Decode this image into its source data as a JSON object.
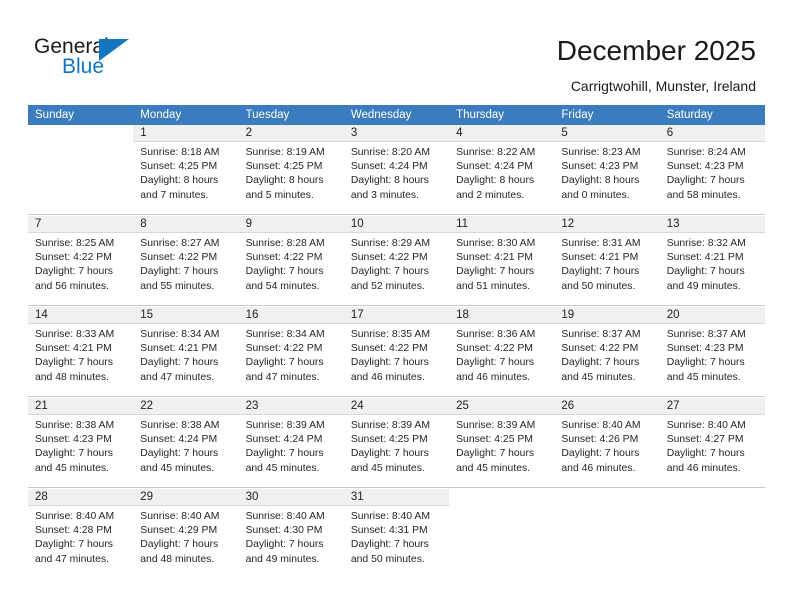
{
  "brand": {
    "name_part1": "General",
    "name_part2": "Blue",
    "triangle_icon": "triangle-icon",
    "accent_color": "#1175c0"
  },
  "header": {
    "title": "December 2025",
    "subtitle": "Carrigtwohill, Munster, Ireland"
  },
  "calendar": {
    "header_color": "#3a7cbe",
    "weekdays": [
      "Sunday",
      "Monday",
      "Tuesday",
      "Wednesday",
      "Thursday",
      "Friday",
      "Saturday"
    ],
    "weeks": [
      [
        {
          "day": "",
          "lines": []
        },
        {
          "day": "1",
          "lines": [
            "Sunrise: 8:18 AM",
            "Sunset: 4:25 PM",
            "Daylight: 8 hours",
            "and 7 minutes."
          ]
        },
        {
          "day": "2",
          "lines": [
            "Sunrise: 8:19 AM",
            "Sunset: 4:25 PM",
            "Daylight: 8 hours",
            "and 5 minutes."
          ]
        },
        {
          "day": "3",
          "lines": [
            "Sunrise: 8:20 AM",
            "Sunset: 4:24 PM",
            "Daylight: 8 hours",
            "and 3 minutes."
          ]
        },
        {
          "day": "4",
          "lines": [
            "Sunrise: 8:22 AM",
            "Sunset: 4:24 PM",
            "Daylight: 8 hours",
            "and 2 minutes."
          ]
        },
        {
          "day": "5",
          "lines": [
            "Sunrise: 8:23 AM",
            "Sunset: 4:23 PM",
            "Daylight: 8 hours",
            "and 0 minutes."
          ]
        },
        {
          "day": "6",
          "lines": [
            "Sunrise: 8:24 AM",
            "Sunset: 4:23 PM",
            "Daylight: 7 hours",
            "and 58 minutes."
          ]
        }
      ],
      [
        {
          "day": "7",
          "lines": [
            "Sunrise: 8:25 AM",
            "Sunset: 4:22 PM",
            "Daylight: 7 hours",
            "and 56 minutes."
          ]
        },
        {
          "day": "8",
          "lines": [
            "Sunrise: 8:27 AM",
            "Sunset: 4:22 PM",
            "Daylight: 7 hours",
            "and 55 minutes."
          ]
        },
        {
          "day": "9",
          "lines": [
            "Sunrise: 8:28 AM",
            "Sunset: 4:22 PM",
            "Daylight: 7 hours",
            "and 54 minutes."
          ]
        },
        {
          "day": "10",
          "lines": [
            "Sunrise: 8:29 AM",
            "Sunset: 4:22 PM",
            "Daylight: 7 hours",
            "and 52 minutes."
          ]
        },
        {
          "day": "11",
          "lines": [
            "Sunrise: 8:30 AM",
            "Sunset: 4:21 PM",
            "Daylight: 7 hours",
            "and 51 minutes."
          ]
        },
        {
          "day": "12",
          "lines": [
            "Sunrise: 8:31 AM",
            "Sunset: 4:21 PM",
            "Daylight: 7 hours",
            "and 50 minutes."
          ]
        },
        {
          "day": "13",
          "lines": [
            "Sunrise: 8:32 AM",
            "Sunset: 4:21 PM",
            "Daylight: 7 hours",
            "and 49 minutes."
          ]
        }
      ],
      [
        {
          "day": "14",
          "lines": [
            "Sunrise: 8:33 AM",
            "Sunset: 4:21 PM",
            "Daylight: 7 hours",
            "and 48 minutes."
          ]
        },
        {
          "day": "15",
          "lines": [
            "Sunrise: 8:34 AM",
            "Sunset: 4:21 PM",
            "Daylight: 7 hours",
            "and 47 minutes."
          ]
        },
        {
          "day": "16",
          "lines": [
            "Sunrise: 8:34 AM",
            "Sunset: 4:22 PM",
            "Daylight: 7 hours",
            "and 47 minutes."
          ]
        },
        {
          "day": "17",
          "lines": [
            "Sunrise: 8:35 AM",
            "Sunset: 4:22 PM",
            "Daylight: 7 hours",
            "and 46 minutes."
          ]
        },
        {
          "day": "18",
          "lines": [
            "Sunrise: 8:36 AM",
            "Sunset: 4:22 PM",
            "Daylight: 7 hours",
            "and 46 minutes."
          ]
        },
        {
          "day": "19",
          "lines": [
            "Sunrise: 8:37 AM",
            "Sunset: 4:22 PM",
            "Daylight: 7 hours",
            "and 45 minutes."
          ]
        },
        {
          "day": "20",
          "lines": [
            "Sunrise: 8:37 AM",
            "Sunset: 4:23 PM",
            "Daylight: 7 hours",
            "and 45 minutes."
          ]
        }
      ],
      [
        {
          "day": "21",
          "lines": [
            "Sunrise: 8:38 AM",
            "Sunset: 4:23 PM",
            "Daylight: 7 hours",
            "and 45 minutes."
          ]
        },
        {
          "day": "22",
          "lines": [
            "Sunrise: 8:38 AM",
            "Sunset: 4:24 PM",
            "Daylight: 7 hours",
            "and 45 minutes."
          ]
        },
        {
          "day": "23",
          "lines": [
            "Sunrise: 8:39 AM",
            "Sunset: 4:24 PM",
            "Daylight: 7 hours",
            "and 45 minutes."
          ]
        },
        {
          "day": "24",
          "lines": [
            "Sunrise: 8:39 AM",
            "Sunset: 4:25 PM",
            "Daylight: 7 hours",
            "and 45 minutes."
          ]
        },
        {
          "day": "25",
          "lines": [
            "Sunrise: 8:39 AM",
            "Sunset: 4:25 PM",
            "Daylight: 7 hours",
            "and 45 minutes."
          ]
        },
        {
          "day": "26",
          "lines": [
            "Sunrise: 8:40 AM",
            "Sunset: 4:26 PM",
            "Daylight: 7 hours",
            "and 46 minutes."
          ]
        },
        {
          "day": "27",
          "lines": [
            "Sunrise: 8:40 AM",
            "Sunset: 4:27 PM",
            "Daylight: 7 hours",
            "and 46 minutes."
          ]
        }
      ],
      [
        {
          "day": "28",
          "lines": [
            "Sunrise: 8:40 AM",
            "Sunset: 4:28 PM",
            "Daylight: 7 hours",
            "and 47 minutes."
          ]
        },
        {
          "day": "29",
          "lines": [
            "Sunrise: 8:40 AM",
            "Sunset: 4:29 PM",
            "Daylight: 7 hours",
            "and 48 minutes."
          ]
        },
        {
          "day": "30",
          "lines": [
            "Sunrise: 8:40 AM",
            "Sunset: 4:30 PM",
            "Daylight: 7 hours",
            "and 49 minutes."
          ]
        },
        {
          "day": "31",
          "lines": [
            "Sunrise: 8:40 AM",
            "Sunset: 4:31 PM",
            "Daylight: 7 hours",
            "and 50 minutes."
          ]
        },
        {
          "day": "",
          "lines": []
        },
        {
          "day": "",
          "lines": []
        },
        {
          "day": "",
          "lines": []
        }
      ]
    ]
  }
}
